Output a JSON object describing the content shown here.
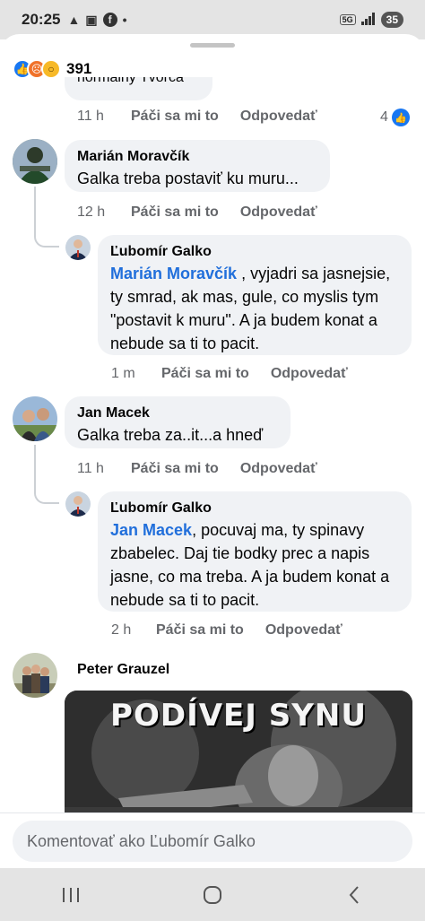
{
  "status": {
    "time": "20:25",
    "battery": "35"
  },
  "post": {
    "reaction_count": "391"
  },
  "previous_comment": {
    "text_fragment": "normálny Tvorca",
    "time": "11 h",
    "like": "Páči sa mi to",
    "reply": "Odpovedať",
    "like_count": "4"
  },
  "comments": [
    {
      "author": "Marián Moravčík",
      "text": "Galka treba postaviť ku muru...",
      "time": "12 h",
      "like": "Páči sa mi to",
      "reply": "Odpovedať",
      "reply_item": {
        "author": "Ľubomír Galko",
        "mention": "Marián Moravčík",
        "text": " , vyjadri sa jasnejsie, ty smrad, ak mas, gule, co myslis tym \"postavit k muru\". A ja budem konat a nebude sa ti to pacit.",
        "time": "1 m",
        "like": "Páči sa mi to",
        "reply": "Odpovedať"
      }
    },
    {
      "author": "Jan Macek",
      "text": "Galka treba za..it...a hneď",
      "time": "11 h",
      "like": "Páči sa mi to",
      "reply": "Odpovedať",
      "reply_item": {
        "author": "Ľubomír Galko",
        "mention": "Jan Macek",
        "text": ", pocuvaj ma, ty spinavy zbabelec. Daj tie bodky prec a napis jasne, co ma treba. A ja budem konat a nebude sa ti to pacit.",
        "time": "2 h",
        "like": "Páči sa mi to",
        "reply": "Odpovedať"
      }
    },
    {
      "author": "Peter Grauzel",
      "image_caption": "PODÍVEJ SYNU"
    }
  ],
  "composer": {
    "placeholder": "Komentovať ako Ľubomír Galko"
  },
  "colors": {
    "accent": "#1877f2",
    "mention": "#216fdb",
    "bubble": "#f0f2f5",
    "meta": "#65676b"
  }
}
